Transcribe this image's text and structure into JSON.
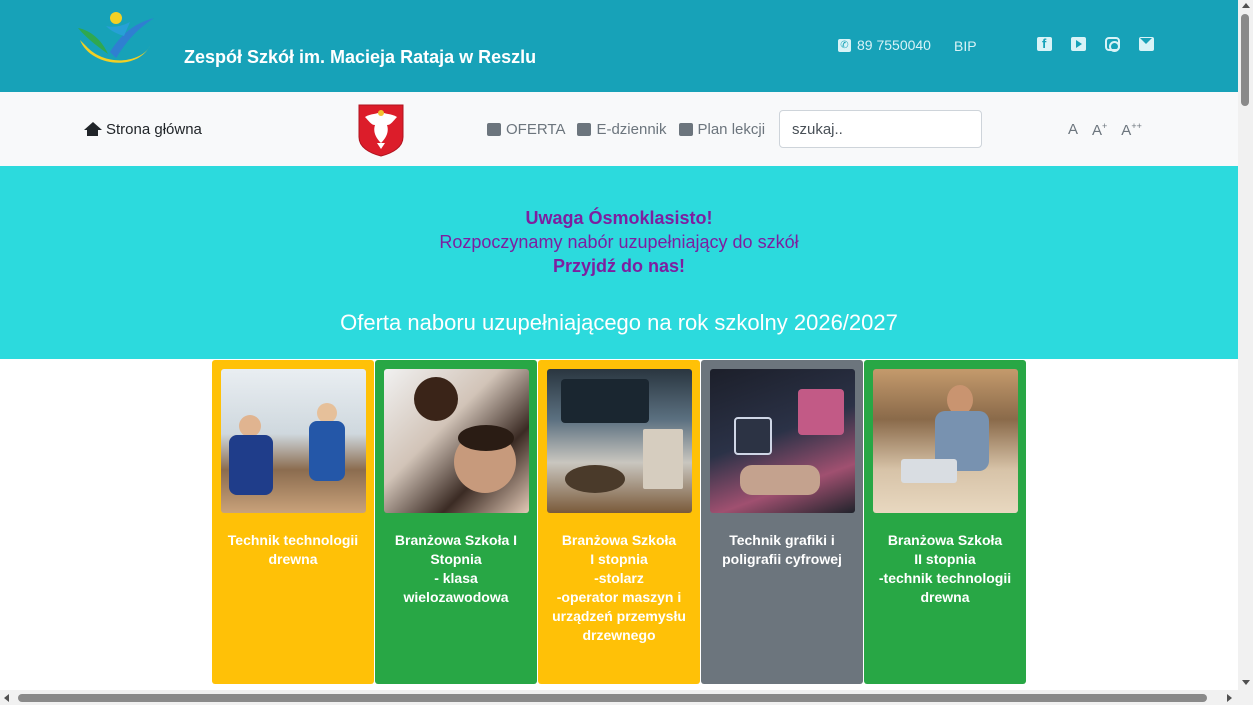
{
  "header": {
    "site_title": "Zespół Szkół im. Macieja Rataja w Reszlu",
    "phone": "89 7550040",
    "bip": "BIP",
    "social_icons": [
      "facebook-icon",
      "youtube-icon",
      "instagram-icon",
      "envelope-icon"
    ]
  },
  "nav": {
    "home": "Strona główna",
    "offer": "OFERTA",
    "ediary": "E-dziennik",
    "schedule": "Plan lekcji",
    "search_placeholder": "szukaj..",
    "font_small": "A",
    "font_medium": "A",
    "font_medium_sup": "+",
    "font_large": "A",
    "font_large_sup": "++"
  },
  "banner": {
    "line1": "Uwaga Ósmoklasisto!",
    "line2": "Rozpoczynamy nabór uzupełniający do szkół",
    "line3": "Przyjdź do nas!",
    "offer_title": "Oferta naboru uzupełniającego na rok szkolny 2026/2027",
    "bg_color": "#2cdadd",
    "text_color": "#7d1fa0"
  },
  "cards": [
    {
      "label": "Technik technologii drewna",
      "color": "#ffc107"
    },
    {
      "label": "Branżowa Szkoła I Stopnia\n- klasa wielozawodowa",
      "color": "#28a745"
    },
    {
      "label": "Branżowa Szkoła\nI stopnia\n-stolarz\n-operator maszyn i urządzeń przemysłu drzewnego",
      "color": "#ffc107"
    },
    {
      "label": "Technik grafiki i poligrafii cyfrowej",
      "color": "#6c757d"
    },
    {
      "label": "Branżowa Szkoła\nII stopnia\n-technik technologii drewna",
      "color": "#28a745"
    }
  ],
  "colors": {
    "topbar": "#17a2b8",
    "navbar": "#f8f9fa"
  }
}
